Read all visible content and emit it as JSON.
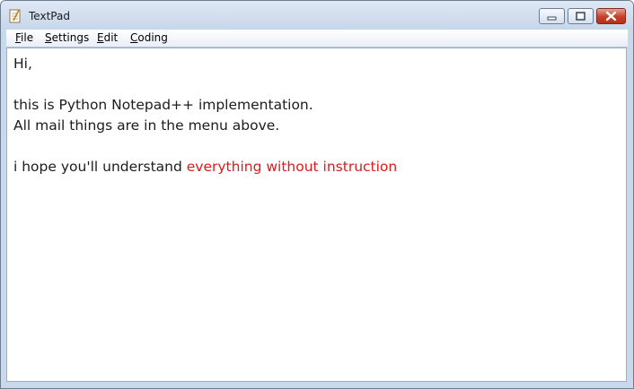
{
  "window": {
    "title": "TextPad"
  },
  "menu": [
    {
      "underline": "F",
      "rest": "ile"
    },
    {
      "underline": "S",
      "rest": "ettings"
    },
    {
      "underline": "E",
      "rest": "dit"
    },
    {
      "underline": "C",
      "rest": "oding"
    }
  ],
  "editor": {
    "line1": "Hi,",
    "line2": "",
    "line3": "this is Python Notepad++ implementation.",
    "line4": "All mail things are in the menu above.",
    "line5": "",
    "line6_black": "i hope you'll understand ",
    "line6_red": "everything without instruction"
  },
  "colors": {
    "highlight_text": "#e01919",
    "close_button": "#c5402a"
  },
  "icons": [
    "notepad-icon",
    "minimize-icon",
    "maximize-icon",
    "close-icon"
  ]
}
